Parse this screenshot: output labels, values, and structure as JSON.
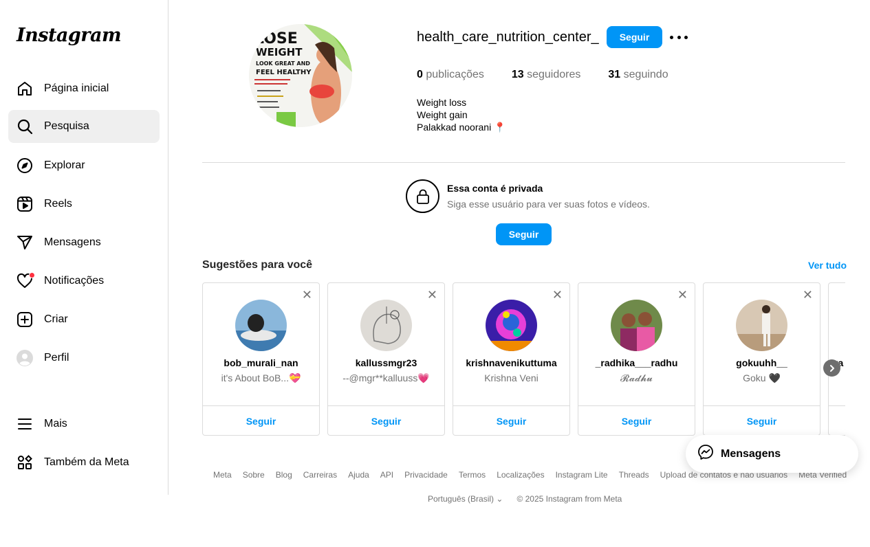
{
  "app": {
    "logo_text": "Instagram"
  },
  "sidebar": {
    "items": [
      {
        "label": "Página inicial",
        "icon": "home-icon"
      },
      {
        "label": "Pesquisa",
        "icon": "search-icon",
        "active": true
      },
      {
        "label": "Explorar",
        "icon": "compass-icon"
      },
      {
        "label": "Reels",
        "icon": "reels-icon"
      },
      {
        "label": "Mensagens",
        "icon": "send-icon"
      },
      {
        "label": "Notificações",
        "icon": "heart-icon",
        "badge_color": "#ff3040"
      },
      {
        "label": "Criar",
        "icon": "plus-square-icon"
      },
      {
        "label": "Perfil",
        "icon": "avatar-icon"
      },
      {
        "label": "Mais",
        "icon": "menu-icon"
      },
      {
        "label": "Também da Meta",
        "icon": "meta-grid-icon"
      }
    ]
  },
  "profile": {
    "username": "health_care_nutrition_center_",
    "follow_label": "Seguir",
    "more_icon": "more-horizontal-icon",
    "avatar_text": [
      "LOSE",
      "WEIGHT",
      "LOOK GREAT AND",
      "FEEL HEALTHY"
    ],
    "stats": {
      "posts_count": "0",
      "posts_label": "publicações",
      "followers_count": "13",
      "followers_label": "seguidores",
      "following_count": "31",
      "following_label": "seguindo"
    },
    "bio": [
      "Weight loss",
      "Weight gain",
      "Palakkad noorani 📍"
    ]
  },
  "private_notice": {
    "icon": "lock-icon",
    "title": "Essa conta é privada",
    "subtitle": "Siga esse usuário para ver suas fotos e vídeos.",
    "follow_label": "Seguir"
  },
  "suggestions": {
    "title": "Sugestões para você",
    "see_all": "Ver tudo",
    "items": [
      {
        "name": "bob_murali_nan",
        "subtitle": "it's About BoB...💝",
        "follow": "Seguir",
        "avatar_color": "#6d9ec6"
      },
      {
        "name": "kallussmgr23",
        "subtitle": "--@mgr**kalluuss💗",
        "follow": "Seguir",
        "avatar_color": "#d9d6d1"
      },
      {
        "name": "krishnavenikuttuma",
        "subtitle": "Krishna Veni",
        "follow": "Seguir",
        "avatar_color": "#5b2bd6"
      },
      {
        "name": "_radhika___radhu",
        "subtitle": "𝓡𝓪𝓭𝓱𝓾",
        "follow": "Seguir",
        "avatar_color": "#b0417a"
      },
      {
        "name": "gokuuhh__",
        "subtitle": "Goku 🖤",
        "follow": "Seguir",
        "avatar_color": "#c9b49b"
      }
    ],
    "partial_name": "ra"
  },
  "footer": {
    "links": [
      "Meta",
      "Sobre",
      "Blog",
      "Carreiras",
      "Ajuda",
      "API",
      "Privacidade",
      "Termos",
      "Localizações",
      "Instagram Lite",
      "Threads",
      "Upload de contatos e não usuários",
      "Meta Verified"
    ],
    "language": "Português (Brasil)",
    "copyright": "© 2025 Instagram from Meta"
  },
  "messages_pill": {
    "label": "Mensagens",
    "icon": "messenger-icon"
  }
}
